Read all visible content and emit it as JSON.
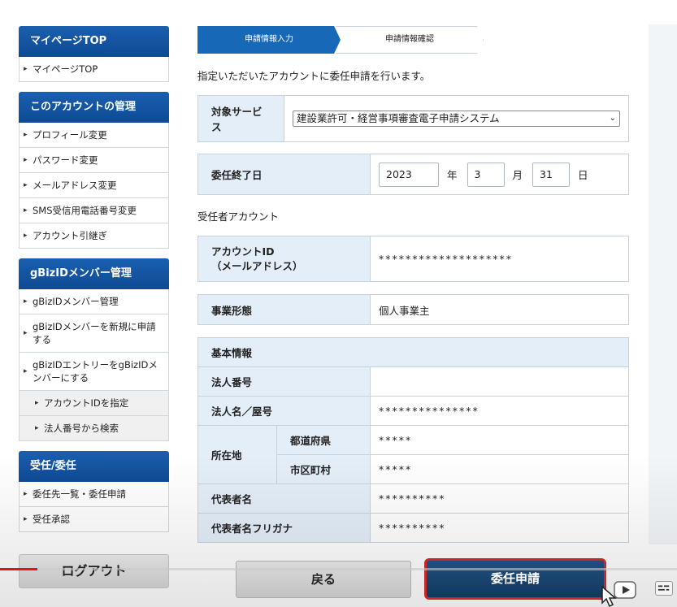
{
  "sidebar": {
    "blocks": [
      {
        "title": "マイページTOP",
        "items": [
          "マイページTOP"
        ]
      },
      {
        "title": "このアカウントの管理",
        "items": [
          "プロフィール変更",
          "パスワード変更",
          "メールアドレス変更",
          "SMS受信用電話番号変更",
          "アカウント引継ぎ"
        ]
      },
      {
        "title": "gBizIDメンバー管理",
        "items": [
          "gBizIDメンバー管理",
          "gBizIDメンバーを新規に申請する",
          "gBizIDエントリーをgBizIDメンバーにする",
          "アカウントIDを指定",
          "法人番号から検索"
        ]
      },
      {
        "title": "受任/委任",
        "items": [
          "委任先一覧・委任申請",
          "受任承認"
        ]
      }
    ]
  },
  "steps": {
    "step1": "申請情報入力",
    "step2": "申請情報確認"
  },
  "intro": "指定いただいたアカウントに委任申請を行います。",
  "service": {
    "label": "対象サービス",
    "value": "建設業許可・経営事項審査電子申請システム"
  },
  "end_date": {
    "label": "委任終了日",
    "year": "2023",
    "year_unit": "年",
    "month": "3",
    "month_unit": "月",
    "day": "31",
    "day_unit": "日"
  },
  "section_label": "受任者アカウント",
  "account": {
    "label_line1": "アカウントID",
    "label_line2": "（メールアドレス）",
    "value": "********************"
  },
  "business_type": {
    "label": "事業形態",
    "value": "個人事業主"
  },
  "basic": {
    "heading": "基本情報",
    "corp_number_label": "法人番号",
    "corp_number_value": "",
    "corp_name_label": "法人名／屋号",
    "corp_name_value": "***************",
    "address_label": "所在地",
    "prefecture_label": "都道府県",
    "prefecture_value": "*****",
    "city_label": "市区町村",
    "city_value": "*****",
    "rep_label": "代表者名",
    "rep_value": "**********",
    "rep_kana_label": "代表者名フリガナ",
    "rep_kana_value": "**********"
  },
  "buttons": {
    "logout": "ログアウト",
    "back": "戻る",
    "apply": "委任申請"
  },
  "colors": {
    "primary": "#1868b8",
    "sidebar_head": "#0e4a94",
    "apply": "#12385e",
    "highlight": "#c6282a"
  },
  "icons": [
    "chevron-down-icon",
    "play-icon",
    "captions-icon",
    "cursor-icon"
  ]
}
